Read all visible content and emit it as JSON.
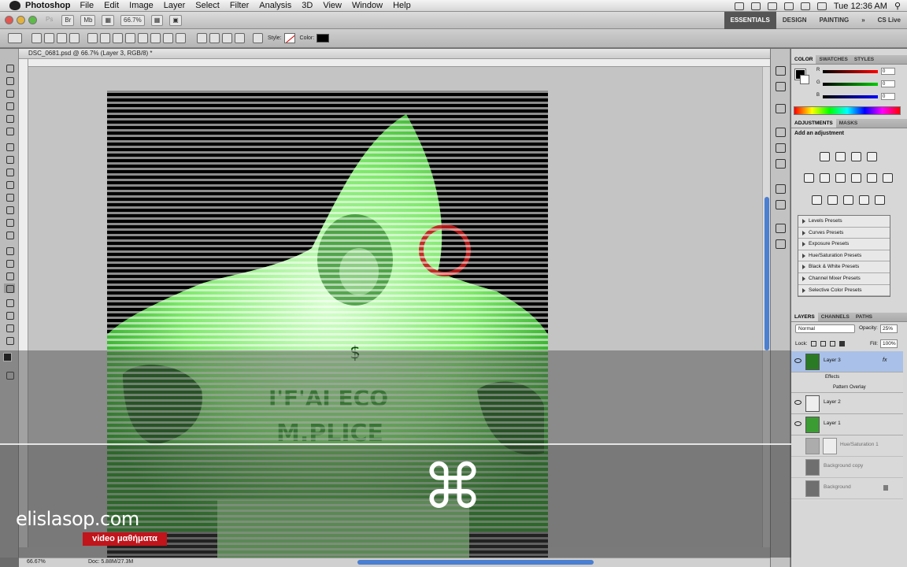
{
  "menubar": {
    "app_name": "Photoshop",
    "items": [
      "File",
      "Edit",
      "Image",
      "Layer",
      "Select",
      "Filter",
      "Analysis",
      "3D",
      "View",
      "Window",
      "Help"
    ],
    "clock": "Tue 12:36 AM"
  },
  "appbar": {
    "zoom": "66.7%",
    "workspaces": [
      "ESSENTIALS",
      "DESIGN",
      "PAINTING",
      "»",
      "CS Live"
    ],
    "active_workspace": "ESSENTIALS"
  },
  "options": {
    "style_label": "Style:",
    "color_label": "Color:"
  },
  "document": {
    "tab_title": "DSC_0681.psd @ 66.7% (Layer 3, RGB/8) *"
  },
  "statusbar": {
    "zoom": "66.67%",
    "doc_size": "Doc: 5.88M/27.3M"
  },
  "panels": {
    "color_tabs": [
      "COLOR",
      "SWATCHES",
      "STYLES"
    ],
    "color_values": [
      {
        "label": "R",
        "value": "0"
      },
      {
        "label": "G",
        "value": "0"
      },
      {
        "label": "B",
        "value": "0"
      }
    ],
    "adj_tabs": [
      "ADJUSTMENTS",
      "MASKS"
    ],
    "adj_title": "Add an adjustment",
    "presets": [
      "Levels Presets",
      "Curves Presets",
      "Exposure Presets",
      "Hue/Saturation Presets",
      "Black & White Presets",
      "Channel Mixer Presets",
      "Selective Color Presets"
    ],
    "layer_tabs": [
      "LAYERS",
      "CHANNELS",
      "PATHS"
    ],
    "blend_mode": "Normal",
    "opacity_label": "Opacity:",
    "opacity_value": "25%",
    "lock_label": "Lock:",
    "fill_label": "Fill:",
    "fill_value": "100%",
    "layers": [
      {
        "name": "Layer 3",
        "fx": "fx"
      },
      {
        "name": "Effects"
      },
      {
        "name": "Pattern Overlay"
      },
      {
        "name": "Layer 2"
      },
      {
        "name": "Layer 1"
      },
      {
        "name": "Hue/Saturation 1"
      },
      {
        "name": "Background copy"
      },
      {
        "name": "Background"
      }
    ]
  },
  "overlay": {
    "command_glyph": "⌘",
    "brand": "elislasop.com",
    "brand_sub": "video μαθήματα"
  }
}
